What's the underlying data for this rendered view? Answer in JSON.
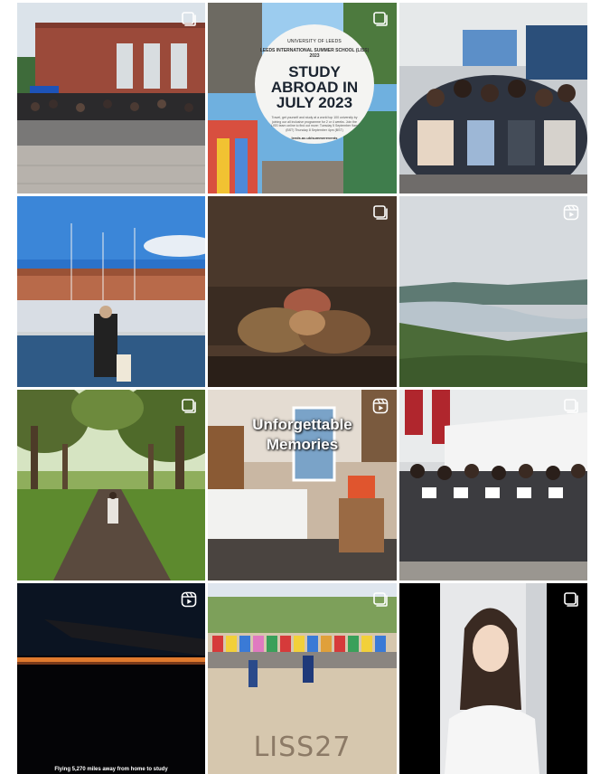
{
  "feed": {
    "posts": [
      {
        "name": "group-photo-brick-building",
        "badge": "carousel"
      },
      {
        "name": "study-abroad-poster",
        "badge": "carousel",
        "poster": {
          "university": "UNIVERSITY OF LEEDS",
          "subtitle": "LEEDS INTERNATIONAL SUMMER SCHOOL (LISS) 2023",
          "title": "STUDY ABROAD IN JULY 2023",
          "body": "Travel, get yourself and study at a world top 100 university by joining our all inclusive programme for 2 or 4 weeks. Join the LISS team online to find out more: Tuesday 5 September 9am (BST) Thursday 8 September 4pm (BST)",
          "link": "leeds.ac.uk/summerevents"
        }
      },
      {
        "name": "classroom-group-photo",
        "badge": "none"
      },
      {
        "name": "harbour-portrait",
        "badge": "none"
      },
      {
        "name": "bread-still-life",
        "badge": "carousel"
      },
      {
        "name": "lake-district-view",
        "badge": "reel"
      },
      {
        "name": "tree-lined-path",
        "badge": "carousel"
      },
      {
        "name": "dorm-room-reel",
        "badge": "reel",
        "overlay_text": "Unforgettable\nMemories"
      },
      {
        "name": "certificate-group-photo",
        "badge": "carousel"
      },
      {
        "name": "plane-window-sunset",
        "badge": "reel",
        "overlay_text": "Flying 5,270 miles away from home to study"
      },
      {
        "name": "beach-jump-liss",
        "badge": "carousel",
        "sand_text": "LISS27"
      },
      {
        "name": "student-video-portrait",
        "badge": "carousel"
      }
    ]
  },
  "icons": {
    "carousel": "carousel-icon",
    "reel": "reel-icon"
  }
}
